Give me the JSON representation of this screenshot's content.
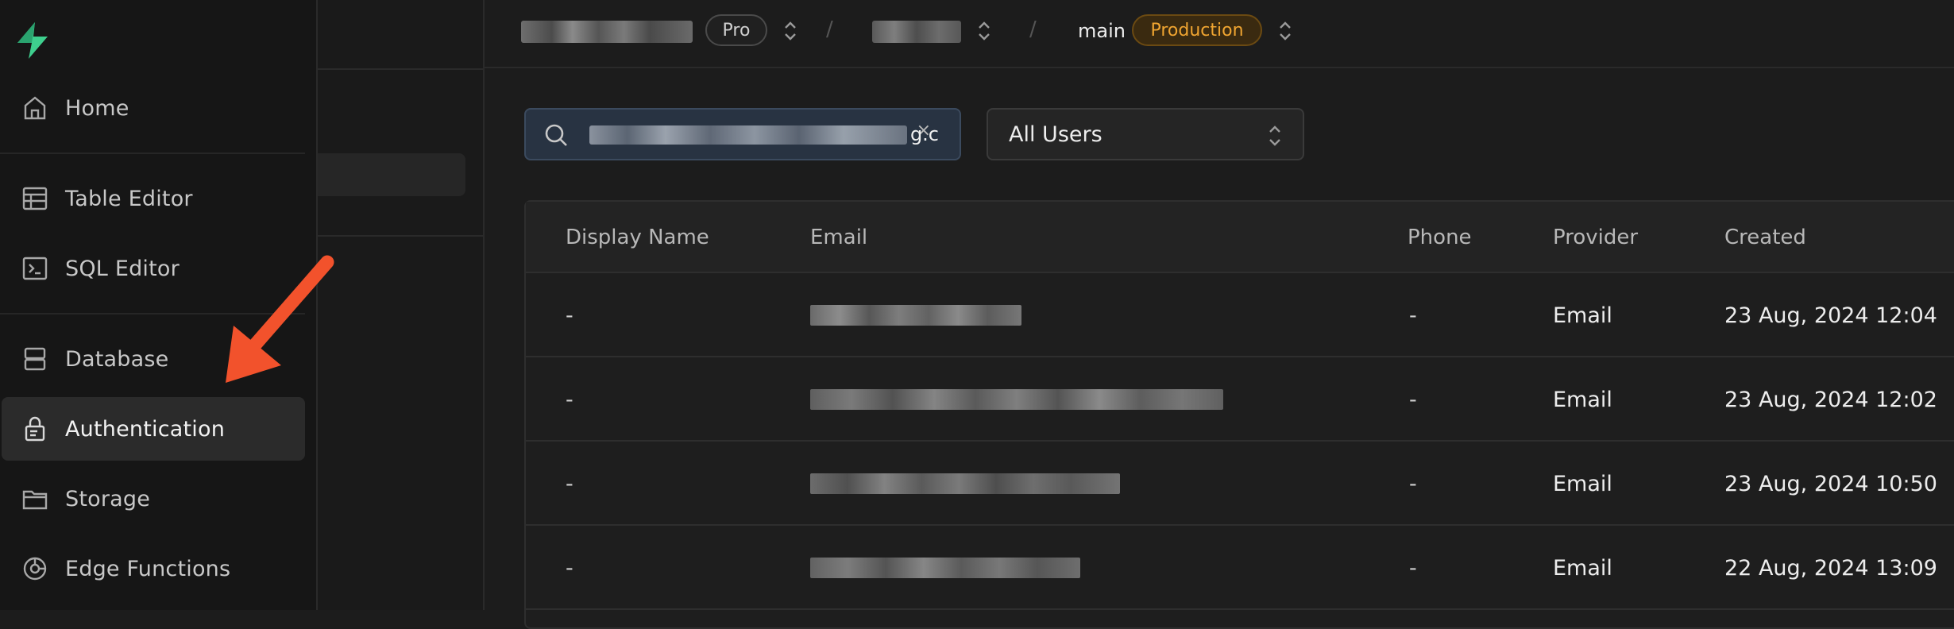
{
  "sidebar": {
    "items": [
      {
        "label": "Home",
        "icon": "home-icon"
      },
      {
        "label": "Table Editor",
        "icon": "table-icon"
      },
      {
        "label": "SQL Editor",
        "icon": "terminal-icon"
      },
      {
        "label": "Database",
        "icon": "database-icon"
      },
      {
        "label": "Authentication",
        "icon": "lock-icon",
        "active": true
      },
      {
        "label": "Storage",
        "icon": "folder-icon"
      },
      {
        "label": "Edge Functions",
        "icon": "functions-icon"
      }
    ]
  },
  "topbar": {
    "plan_badge": "Pro",
    "branch": "main",
    "env_badge": "Production"
  },
  "search": {
    "visible_tail": "g.c",
    "clear_glyph": "×"
  },
  "filter": {
    "selected": "All Users"
  },
  "table": {
    "headers": [
      "Display Name",
      "Email",
      "Phone",
      "Provider",
      "Created"
    ],
    "rows": [
      {
        "display_name": "-",
        "phone": "-",
        "provider": "Email",
        "created": "23 Aug, 2024 12:04"
      },
      {
        "display_name": "-",
        "phone": "-",
        "provider": "Email",
        "created": "23 Aug, 2024 12:02"
      },
      {
        "display_name": "-",
        "phone": "-",
        "provider": "Email",
        "created": "23 Aug, 2024 10:50"
      },
      {
        "display_name": "-",
        "phone": "-",
        "provider": "Email",
        "created": "22 Aug, 2024 13:09"
      }
    ]
  },
  "colors": {
    "accent_green": "#3ecf8e",
    "annotation_arrow": "#f2522c",
    "production_badge": "#f0a531"
  }
}
